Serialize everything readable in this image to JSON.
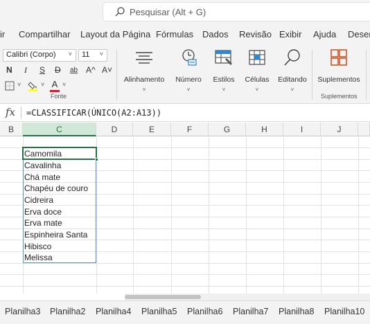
{
  "search": {
    "placeholder": "Pesquisar (Alt + G)"
  },
  "menu": {
    "tabs": [
      "ir",
      "Compartilhar",
      "Layout da Página",
      "Fórmulas",
      "Dados",
      "Revisão",
      "Exibir",
      "Ajuda",
      "Desen"
    ]
  },
  "ribbon": {
    "font_name": "Calibri (Corpo)",
    "font_size": "11",
    "font_group_label": "Fonte",
    "fmt": {
      "bold": "N",
      "italic": "I",
      "underline": "S",
      "strike": "D",
      "subscript": "ab",
      "grow": "A^",
      "shrink": "A˅"
    },
    "buttons": {
      "alinhamento": "Alinhamento",
      "numero": "Número",
      "estilos": "Estilos",
      "celulas": "Células",
      "editando": "Editando",
      "suplementos": "Suplementos"
    },
    "suplementos_group_label": "Suplementos",
    "fill_color": "#ffff00",
    "font_color": "#e81123"
  },
  "formula_bar": {
    "fx": "fx",
    "formula": "=CLASSIFICAR(ÚNICO(A2:A13))"
  },
  "columns": [
    {
      "label": "B",
      "selected": false
    },
    {
      "label": "C",
      "selected": true
    },
    {
      "label": "D",
      "selected": false
    },
    {
      "label": "E",
      "selected": false
    },
    {
      "label": "F",
      "selected": false
    },
    {
      "label": "G",
      "selected": false
    },
    {
      "label": "H",
      "selected": false
    },
    {
      "label": "I",
      "selected": false
    },
    {
      "label": "J",
      "selected": false
    }
  ],
  "cells": [
    "Camomila",
    "Cavalinha",
    "Chá mate",
    "Chapéu de couro",
    "Cidreira",
    "Erva doce",
    "Erva mate",
    "Espinheira Santa",
    "Hibisco",
    "Melissa"
  ],
  "sheets": [
    "Planilha3",
    "Planilha2",
    "Planilha4",
    "Planilha5",
    "Planilha6",
    "Planilha7",
    "Planilha8",
    "Planilha10"
  ],
  "colors": {
    "accent": "#217346",
    "spill_border": "#5b8fd0"
  }
}
